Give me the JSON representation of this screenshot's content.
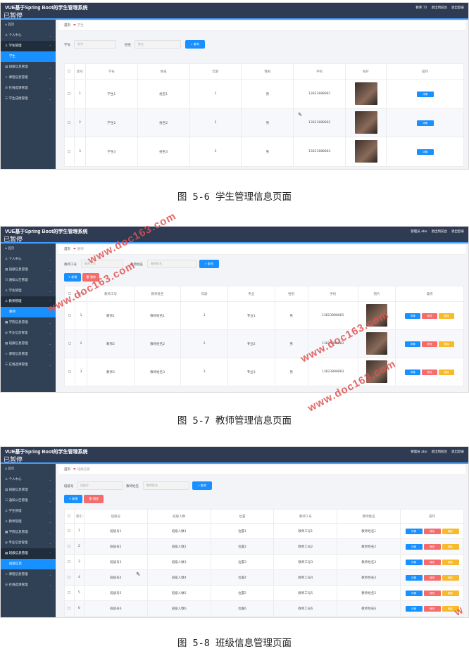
{
  "common": {
    "app_title": "VUE基于Spring Boot的学生管理系统",
    "paused_text": "已暂停",
    "search_btn": "查询",
    "detail_btn": "详情",
    "edit_btn": "修改",
    "delete_btn": "删除",
    "add_btn": "新增",
    "batch_delete_btn": "删除",
    "home": "首页"
  },
  "shot1": {
    "topbar_right": [
      "教师 72",
      "退出到前台",
      "退出登录"
    ],
    "menu": [
      {
        "label": "首页"
      },
      {
        "label": "个人中心"
      },
      {
        "label": "学生管理"
      },
      {
        "label": "学生",
        "sub": true
      },
      {
        "label": "班级信息管理"
      },
      {
        "label": "课程信息管理"
      },
      {
        "label": "在线选课管理"
      },
      {
        "label": "学生成绩管理"
      }
    ],
    "breadcrumb_current": "学生",
    "search": [
      {
        "label": "学号",
        "placeholder": "学号"
      },
      {
        "label": "姓名",
        "placeholder": "姓名"
      }
    ],
    "columns": [
      "索引",
      "学号",
      "姓名",
      "年龄",
      "性别",
      "手机",
      "照片",
      "操作"
    ],
    "rows": [
      {
        "idx": "1",
        "no": "学生1",
        "name": "姓名1",
        "age": "1",
        "sex": "男",
        "phone": "13823888881"
      },
      {
        "idx": "2",
        "no": "学生2",
        "name": "姓名2",
        "age": "2",
        "sex": "男",
        "phone": "13823888882"
      },
      {
        "idx": "3",
        "no": "学生3",
        "name": "姓名3",
        "age": "3",
        "sex": "男",
        "phone": "13823888883"
      }
    ],
    "caption": "图 5-6 学生管理信息页面"
  },
  "shot2": {
    "topbar_right": [
      "管理员 abo",
      "退出到前台",
      "退出登录"
    ],
    "menu": [
      {
        "label": "首页"
      },
      {
        "label": "个人中心"
      },
      {
        "label": "班级信息管理"
      },
      {
        "label": "通知公告管理"
      },
      {
        "label": "学生管理"
      },
      {
        "label": "教师管理"
      },
      {
        "label": "教师",
        "sub": true
      },
      {
        "label": "学院信息管理"
      },
      {
        "label": "专业信息管理"
      },
      {
        "label": "班级信息管理"
      },
      {
        "label": "课程信息管理"
      },
      {
        "label": "在线选课管理"
      }
    ],
    "breadcrumb_current": "教师",
    "search": [
      {
        "label": "教师工号",
        "placeholder": "教师工号"
      },
      {
        "label": "教师姓名",
        "placeholder": "教师姓名"
      }
    ],
    "columns": [
      "索引",
      "教师工号",
      "教师姓名",
      "年龄",
      "专业",
      "性别",
      "手机",
      "照片",
      "操作"
    ],
    "rows": [
      {
        "idx": "1",
        "no": "教师1",
        "name": "教师姓名1",
        "age": "1",
        "major": "专业1",
        "sex": "男",
        "phone": "13823888881"
      },
      {
        "idx": "2",
        "no": "教师2",
        "name": "教师姓名2",
        "age": "2",
        "major": "专业2",
        "sex": "男",
        "phone": "13823888882"
      },
      {
        "idx": "3",
        "no": "教师3",
        "name": "教师姓名3",
        "age": "3",
        "major": "专业3",
        "sex": "男",
        "phone": "13823888883"
      }
    ],
    "caption": "图 5-7 教师管理信息页面"
  },
  "shot3": {
    "topbar_right": [
      "管理员 abo",
      "退出到前台",
      "退出登录"
    ],
    "menu": [
      {
        "label": "首页"
      },
      {
        "label": "个人中心"
      },
      {
        "label": "班级信息管理"
      },
      {
        "label": "通知公告管理"
      },
      {
        "label": "学生管理"
      },
      {
        "label": "教师管理"
      },
      {
        "label": "学院信息管理"
      },
      {
        "label": "专业信息管理"
      },
      {
        "label": "班级信息管理"
      },
      {
        "label": "班级信息",
        "sub": true
      },
      {
        "label": "课程信息管理"
      },
      {
        "label": "在线选课管理"
      }
    ],
    "breadcrumb_current": "班级信息",
    "search": [
      {
        "label": "班级号",
        "placeholder": "班级号"
      },
      {
        "label": "教师姓名",
        "placeholder": "教师姓名"
      }
    ],
    "columns": [
      "索引",
      "班级号",
      "班级人数",
      "位置",
      "教师工号",
      "教师姓名",
      "操作"
    ],
    "rows": [
      {
        "idx": "1",
        "no": "班级号1",
        "count": "班级人数1",
        "loc": "位置1",
        "tno": "教师工号1",
        "tname": "教师姓名1"
      },
      {
        "idx": "2",
        "no": "班级号2",
        "count": "班级人数2",
        "loc": "位置2",
        "tno": "教师工号2",
        "tname": "教师姓名2"
      },
      {
        "idx": "3",
        "no": "班级号3",
        "count": "班级人数3",
        "loc": "位置3",
        "tno": "教师工号3",
        "tname": "教师姓名3"
      },
      {
        "idx": "4",
        "no": "班级号4",
        "count": "班级人数4",
        "loc": "位置4",
        "tno": "教师工号4",
        "tname": "教师姓名4"
      },
      {
        "idx": "5",
        "no": "班级号5",
        "count": "班级人数5",
        "loc": "位置5",
        "tno": "教师工号5",
        "tname": "教师姓名5"
      },
      {
        "idx": "6",
        "no": "班级号6",
        "count": "班级人数6",
        "loc": "位置6",
        "tno": "教师工号6",
        "tname": "教师姓名6"
      }
    ],
    "caption": "图 5-8 班级信息管理页面"
  },
  "watermark": "www.doc163.com",
  "watermark_short": "W"
}
